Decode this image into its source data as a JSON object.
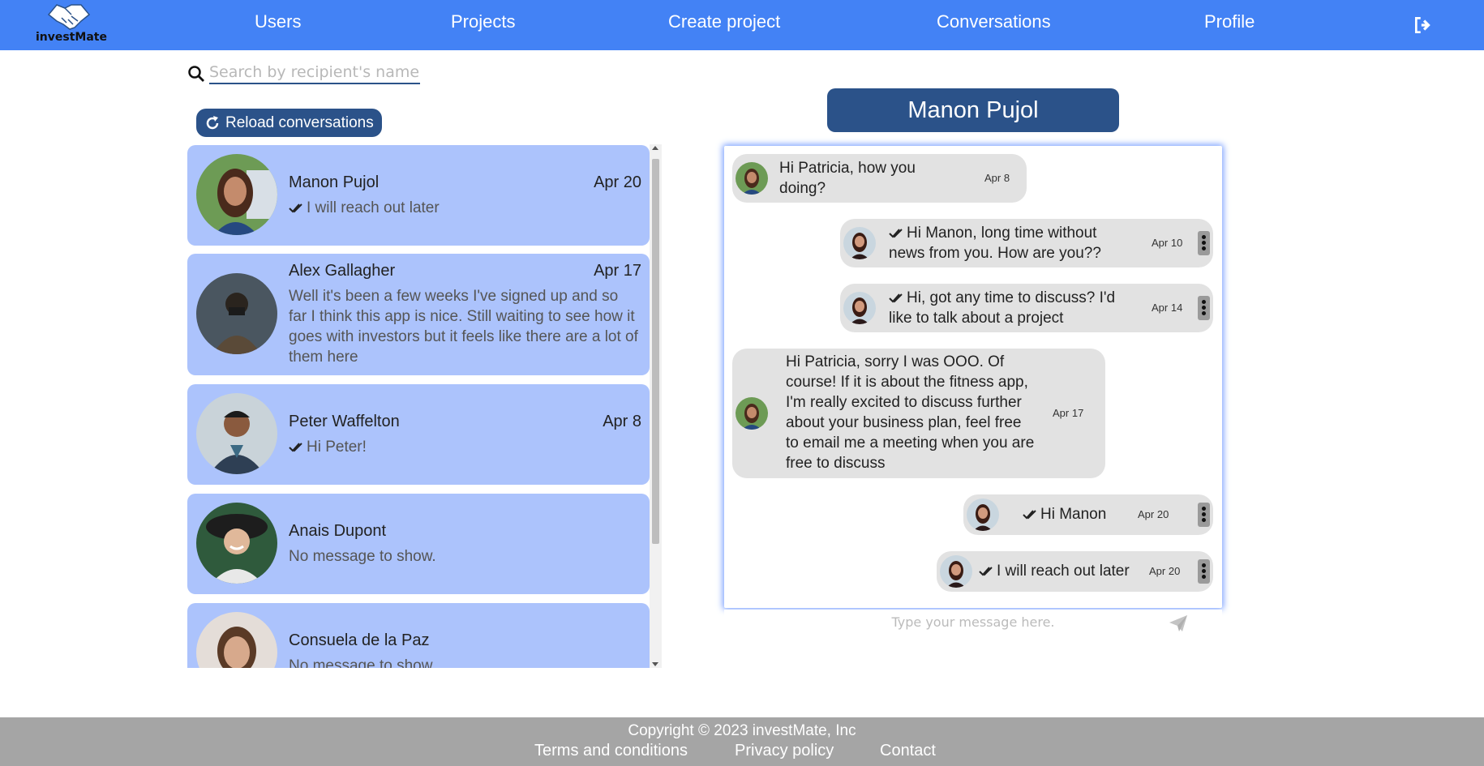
{
  "app": {
    "logo_text": "investMate"
  },
  "nav": {
    "items": [
      "Users",
      "Projects",
      "Create project",
      "Conversations",
      "Profile"
    ],
    "logout_icon": "sign-out-icon",
    "background": "#4382f5"
  },
  "search": {
    "placeholder": "Search by recipient's name",
    "value": ""
  },
  "reload": {
    "label": "Reload conversations",
    "icon": "rotate-icon"
  },
  "conversations": [
    {
      "name": "Manon Pujol",
      "date": "Apr 20",
      "last_message": "I will reach out later",
      "read": true
    },
    {
      "name": "Alex Gallagher",
      "date": "Apr 17",
      "last_message": "Well it's been a few weeks I've signed up and so far I think this app is nice. Still waiting to see how it goes with investors but it feels like there are a lot of them here",
      "read": false
    },
    {
      "name": "Peter Waffelton",
      "date": "Apr 8",
      "last_message": "Hi Peter!",
      "read": true
    },
    {
      "name": "Anais Dupont",
      "date": "",
      "last_message": "No message to show.",
      "read": false
    },
    {
      "name": "Consuela de la Paz",
      "date": "",
      "last_message": "No message to show.",
      "read": false
    }
  ],
  "chat": {
    "recipient": "Manon Pujol",
    "messages": [
      {
        "from": "them",
        "text": "Hi Patricia, how you doing?",
        "date": "Apr 8"
      },
      {
        "from": "me",
        "text": "Hi Manon, long time without news from you. How are you??",
        "date": "Apr 10",
        "read": true
      },
      {
        "from": "me",
        "text": "Hi, got any time to discuss? I'd like to talk about a project",
        "date": "Apr 14",
        "read": true
      },
      {
        "from": "them",
        "text": "Hi Patricia, sorry I was OOO. Of course! If it is about the fitness app, I'm really excited to discuss further about your business plan, feel free to email me a meeting when you are free to discuss",
        "date": "Apr 17"
      },
      {
        "from": "me",
        "text": "Hi Manon",
        "date": "Apr 20",
        "read": true
      },
      {
        "from": "me",
        "text": "I will reach out later",
        "date": "Apr 20",
        "read": true
      }
    ],
    "input_placeholder": "Type your message here.",
    "send_icon": "paper-plane-icon"
  },
  "footer": {
    "copyright": "Copyright © 2023 investMate, Inc",
    "links": [
      "Terms and conditions",
      "Privacy policy",
      "Contact"
    ]
  },
  "colors": {
    "accent": "#2b5289",
    "conversation_card": "#acc3fc",
    "message_bubble": "#e2e2e2",
    "footer": "#a5a5a5"
  }
}
